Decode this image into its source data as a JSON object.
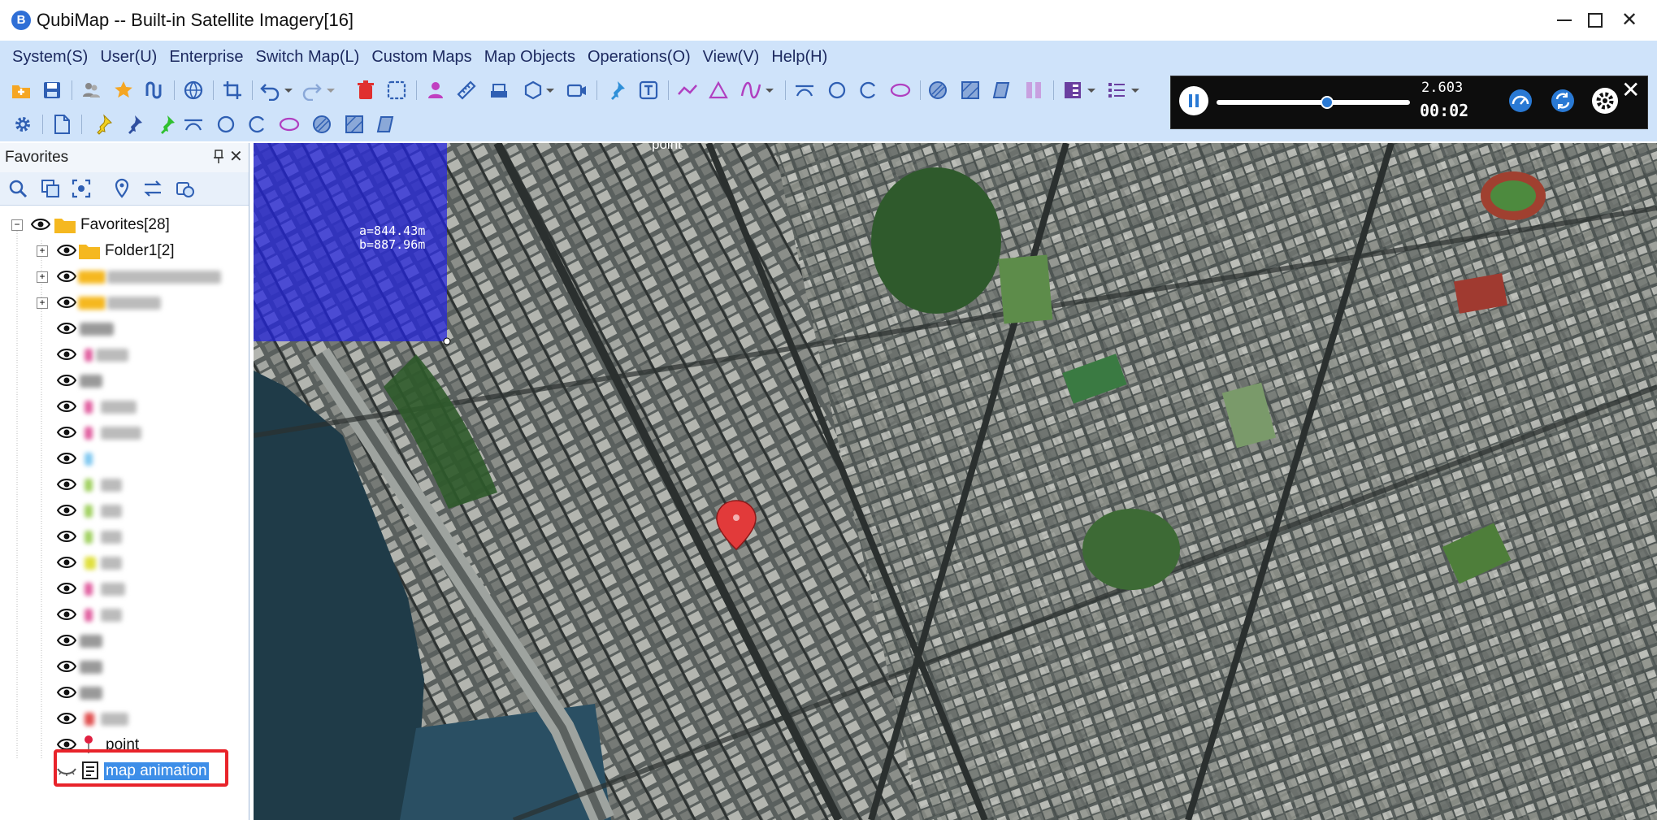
{
  "window": {
    "title": "QubiMap -- Built-in Satellite Imagery[16]",
    "app_icon_letter": "B",
    "minimize": "─",
    "maximize": "☐",
    "close": "✕"
  },
  "menu": [
    "System(S)",
    "User(U)",
    "Enterprise",
    "Switch Map(L)",
    "Custom Maps",
    "Map Objects",
    "Operations(O)",
    "View(V)",
    "Help(H)"
  ],
  "player": {
    "speed": "2.603",
    "time": "00:02",
    "progress": 0.57,
    "close": "✕"
  },
  "sidebar": {
    "title": "Favorites",
    "pin": "📌",
    "close": "✕",
    "tree": {
      "root_label": "Favorites[28]",
      "folder1_label": "Folder1[2]",
      "point_label": "point",
      "animation_label": "map animation"
    }
  },
  "map": {
    "measure_a": "a=844.43m",
    "measure_b": "b=887.96m",
    "top_label": "point"
  },
  "colors": {
    "menubar": "#cfe3fa",
    "selection_overlay": "#2323e0",
    "highlight_box": "#e8232a",
    "selected_item": "#3d8ee8"
  }
}
